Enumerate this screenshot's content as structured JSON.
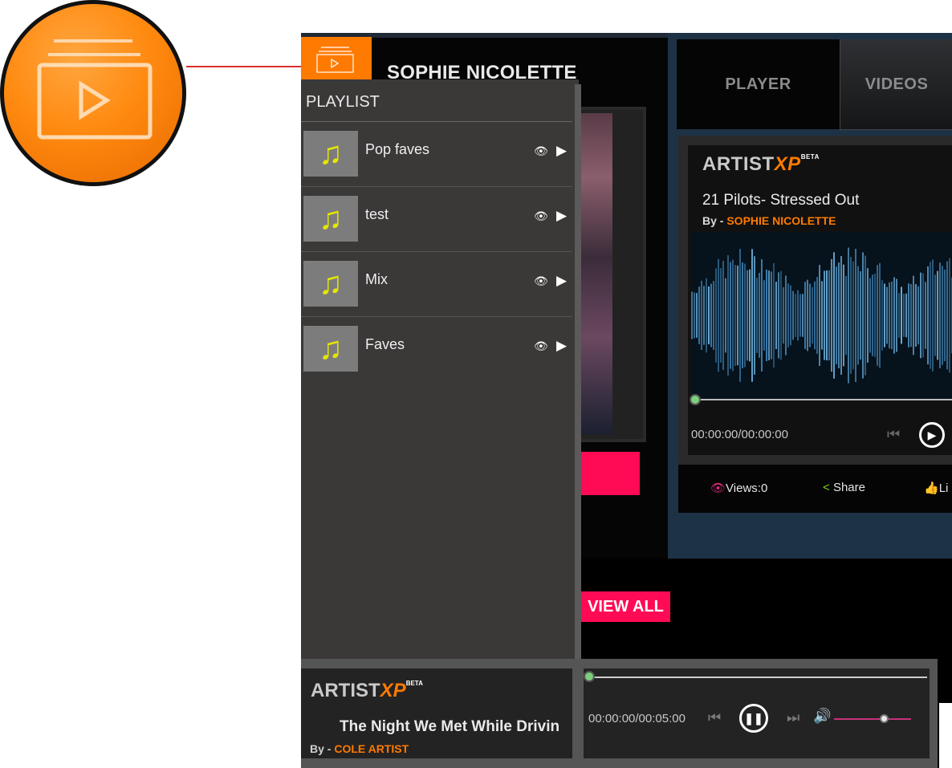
{
  "artist_header": {
    "name": "SOPHIE NICOLETTE"
  },
  "playlist": {
    "heading": "PLAYLIST",
    "items": [
      {
        "label": "Pop faves"
      },
      {
        "label": "test"
      },
      {
        "label": "Mix"
      },
      {
        "label": "Faves"
      }
    ]
  },
  "tabs": {
    "player": "PLAYER",
    "videos": "VIDEOS"
  },
  "player": {
    "logo_main": "ARTIST",
    "logo_accent": "XP",
    "logo_badge": "BETA",
    "track_title": "21 Pilots- Stressed Out",
    "by_prefix": "By - ",
    "artist": "SOPHIE NICOLETTE",
    "time": "00:00:00/00:00:00",
    "progress": 0
  },
  "stats": {
    "views": "Views:0",
    "share": "Share",
    "like": "Li"
  },
  "view_all": "VIEW ALL",
  "mini_player": {
    "logo_main": "ARTIST",
    "logo_accent": "XP",
    "logo_badge": "BETA",
    "track_title": "The Night We Met While Drivin",
    "by_prefix": "By - ",
    "artist": "COLE ARTIST",
    "time": "00:00:00/00:05:00",
    "progress": 0,
    "volume": 0.65
  },
  "colors": {
    "accent": "#ff7a00",
    "pink": "#ff0a54",
    "green": "#7dcf7d",
    "volume": "#c6317a"
  },
  "icons": [
    "playlist-icon",
    "music-note-icon",
    "eye-icon",
    "play-icon",
    "prev-icon",
    "pause-icon",
    "next-icon",
    "volume-icon",
    "share-icon",
    "like-icon"
  ]
}
